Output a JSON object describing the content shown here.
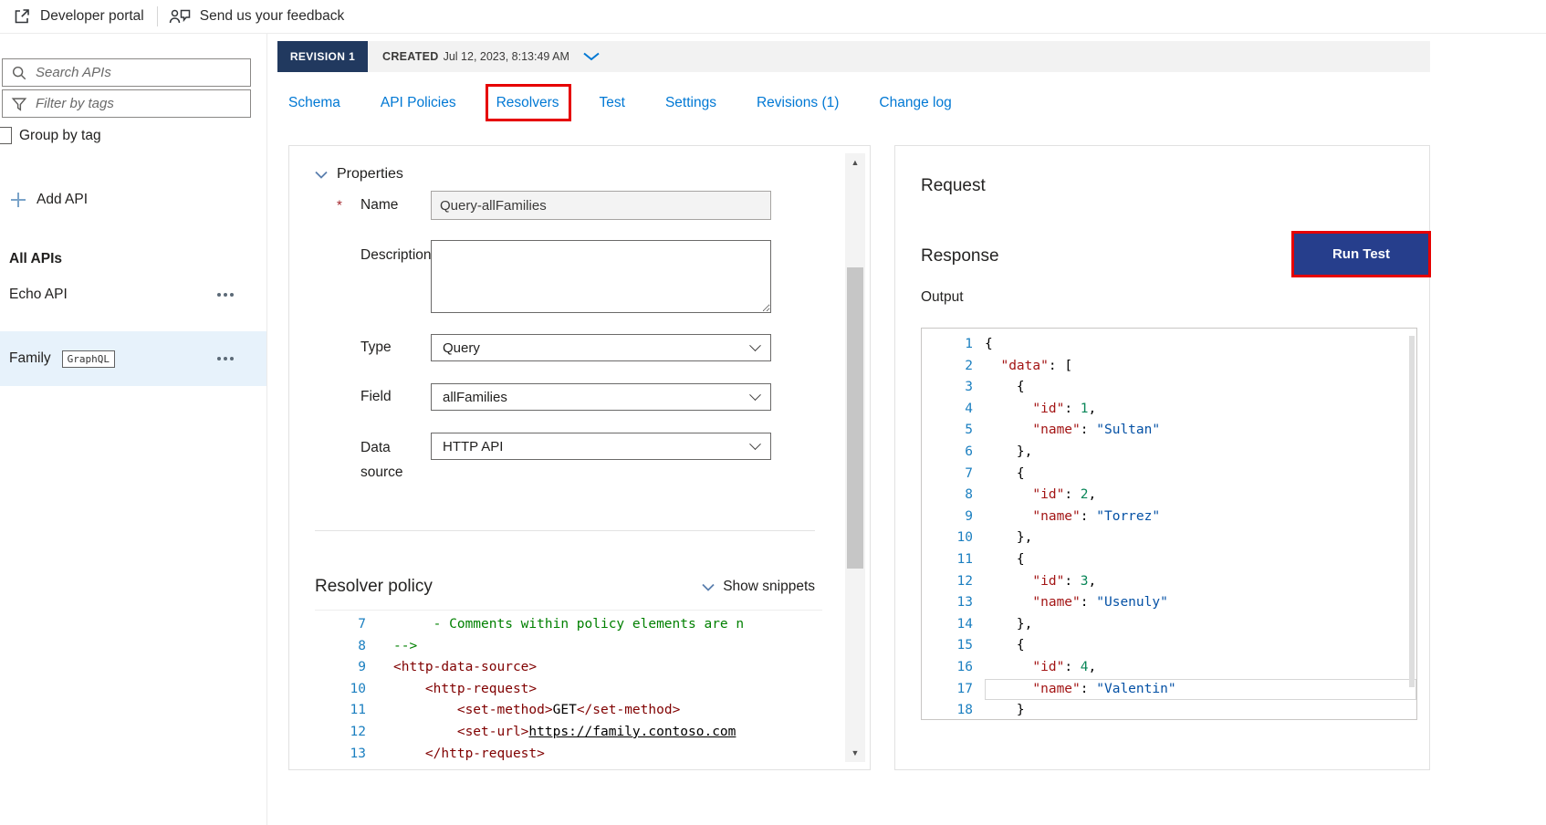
{
  "colors": {
    "accent": "#0078d4",
    "annotation_red": "#e60000",
    "revision_navy": "#21395f",
    "run_test_navy": "#263e8c",
    "selected_item_bg": "#e7f2fb",
    "created_bar_bg": "#f2f2f2",
    "code_key": "#a31515",
    "code_string": "#0451a5",
    "code_number": "#098658",
    "code_comment": "#008000",
    "code_tag": "#800000",
    "line_number": "#1b7fc0"
  },
  "topbar": {
    "developer_portal": "Developer portal",
    "feedback": "Send us your feedback"
  },
  "sidebar": {
    "search_placeholder": "Search APIs",
    "filter_placeholder": "Filter by tags",
    "group_by_tag_label": "Group by tag",
    "add_api_label": "Add API",
    "all_apis_heading": "All APIs",
    "items": [
      {
        "label": "Echo API",
        "badge": ""
      },
      {
        "label": "Family",
        "badge": "GraphQL"
      }
    ]
  },
  "revision_bar": {
    "revision_label": "REVISION 1",
    "created_label": "CREATED",
    "created_value": "Jul 12, 2023, 8:13:49 AM"
  },
  "tabs": [
    {
      "label": "Schema"
    },
    {
      "label": "API Policies"
    },
    {
      "label": "Resolvers"
    },
    {
      "label": "Test"
    },
    {
      "label": "Settings"
    },
    {
      "label": "Revisions (1)"
    },
    {
      "label": "Change log"
    }
  ],
  "properties_panel": {
    "section_title": "Properties",
    "name_label": "Name",
    "name_value": "Query-allFamilies",
    "description_label": "Description",
    "description_value": "",
    "type_label": "Type",
    "type_value": "Query",
    "field_label": "Field",
    "field_value": "allFamilies",
    "data_source_label": "Data source",
    "data_source_value": "HTTP API",
    "resolver_policy_title": "Resolver policy",
    "show_snippets_label": "Show snippets",
    "policy_lines": [
      {
        "n": "7",
        "t": [
          [
            "     - Comments within policy elements are n",
            "comment"
          ]
        ]
      },
      {
        "n": "8",
        "t": [
          [
            "-->",
            "comment"
          ]
        ]
      },
      {
        "n": "9",
        "t": [
          [
            "<http-data-source>",
            "tag"
          ]
        ]
      },
      {
        "n": "10",
        "t": [
          [
            "    ",
            ""
          ],
          [
            "<http-request>",
            "tag"
          ]
        ]
      },
      {
        "n": "11",
        "t": [
          [
            "        ",
            ""
          ],
          [
            "<set-method>",
            "tag"
          ],
          [
            "GET",
            ""
          ],
          [
            "</set-method>",
            "tag"
          ]
        ]
      },
      {
        "n": "12",
        "t": [
          [
            "        ",
            ""
          ],
          [
            "<set-url>",
            "tag"
          ],
          [
            "https://family.contoso.com",
            "link"
          ]
        ]
      },
      {
        "n": "13",
        "t": [
          [
            "    ",
            ""
          ],
          [
            "</http-request>",
            "tag"
          ]
        ]
      }
    ]
  },
  "test_panel": {
    "request_title": "Request",
    "response_title": "Response",
    "run_test_label": "Run Test",
    "output_label": "Output",
    "output_lines": [
      {
        "n": "1",
        "t": [
          [
            "{",
            ""
          ]
        ]
      },
      {
        "n": "2",
        "t": [
          [
            "  ",
            ""
          ],
          [
            "\"data\"",
            "key"
          ],
          [
            ": [",
            ""
          ]
        ]
      },
      {
        "n": "3",
        "t": [
          [
            "    {",
            ""
          ]
        ]
      },
      {
        "n": "4",
        "t": [
          [
            "      ",
            ""
          ],
          [
            "\"id\"",
            "key"
          ],
          [
            ": ",
            ""
          ],
          [
            "1",
            "num"
          ],
          [
            ",",
            ""
          ]
        ]
      },
      {
        "n": "5",
        "t": [
          [
            "      ",
            ""
          ],
          [
            "\"name\"",
            "key"
          ],
          [
            ": ",
            ""
          ],
          [
            "\"Sultan\"",
            "str"
          ]
        ]
      },
      {
        "n": "6",
        "t": [
          [
            "    },",
            ""
          ]
        ]
      },
      {
        "n": "7",
        "t": [
          [
            "    {",
            ""
          ]
        ]
      },
      {
        "n": "8",
        "t": [
          [
            "      ",
            ""
          ],
          [
            "\"id\"",
            "key"
          ],
          [
            ": ",
            ""
          ],
          [
            "2",
            "num"
          ],
          [
            ",",
            ""
          ]
        ]
      },
      {
        "n": "9",
        "t": [
          [
            "      ",
            ""
          ],
          [
            "\"name\"",
            "key"
          ],
          [
            ": ",
            ""
          ],
          [
            "\"Torrez\"",
            "str"
          ]
        ]
      },
      {
        "n": "10",
        "t": [
          [
            "    },",
            ""
          ]
        ]
      },
      {
        "n": "11",
        "t": [
          [
            "    {",
            ""
          ]
        ]
      },
      {
        "n": "12",
        "t": [
          [
            "      ",
            ""
          ],
          [
            "\"id\"",
            "key"
          ],
          [
            ": ",
            ""
          ],
          [
            "3",
            "num"
          ],
          [
            ",",
            ""
          ]
        ]
      },
      {
        "n": "13",
        "t": [
          [
            "      ",
            ""
          ],
          [
            "\"name\"",
            "key"
          ],
          [
            ": ",
            ""
          ],
          [
            "\"Usenuly\"",
            "str"
          ]
        ]
      },
      {
        "n": "14",
        "t": [
          [
            "    },",
            ""
          ]
        ]
      },
      {
        "n": "15",
        "t": [
          [
            "    {",
            ""
          ]
        ]
      },
      {
        "n": "16",
        "t": [
          [
            "      ",
            ""
          ],
          [
            "\"id\"",
            "key"
          ],
          [
            ": ",
            ""
          ],
          [
            "4",
            "num"
          ],
          [
            ",",
            ""
          ]
        ]
      },
      {
        "n": "17",
        "cur": true,
        "t": [
          [
            "      ",
            ""
          ],
          [
            "\"name\"",
            "key"
          ],
          [
            ": ",
            ""
          ],
          [
            "\"Valentin\"",
            "str"
          ]
        ]
      },
      {
        "n": "18",
        "t": [
          [
            "    }",
            ""
          ]
        ]
      }
    ]
  }
}
